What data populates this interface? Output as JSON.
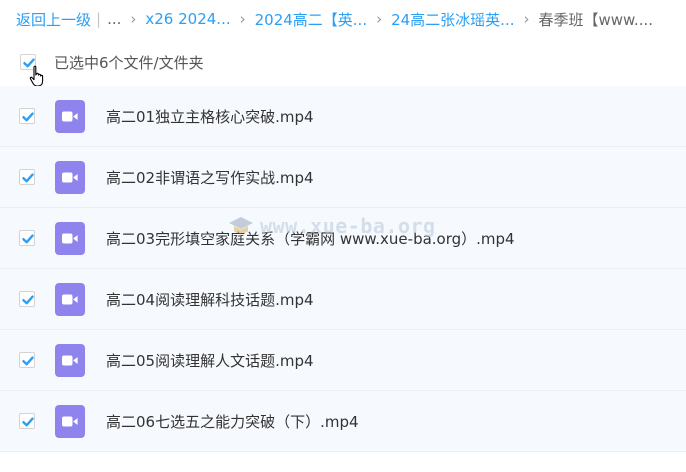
{
  "breadcrumb": {
    "back_label": "返回上一级",
    "sep_bar": "|",
    "ellipsis": "...",
    "sep": "›",
    "items": [
      "x26 2024...",
      "2024高二【英...",
      "24高二张冰瑶英..."
    ],
    "current": "春季班【www...."
  },
  "selection": {
    "label": "已选中6个文件/文件夹",
    "all_checked": true
  },
  "files": [
    {
      "name": "高二01独立主格核心突破.mp4",
      "checked": true,
      "type_icon": "video-file-icon"
    },
    {
      "name": "高二02非谓语之写作实战.mp4",
      "checked": true,
      "type_icon": "video-file-icon"
    },
    {
      "name": "高二03完形填空家庭关系（学霸网 www.xue-ba.org）.mp4",
      "checked": true,
      "type_icon": "video-file-icon"
    },
    {
      "name": "高二04阅读理解科技话题.mp4",
      "checked": true,
      "type_icon": "video-file-icon"
    },
    {
      "name": "高二05阅读理解人文话题.mp4",
      "checked": true,
      "type_icon": "video-file-icon"
    },
    {
      "name": "高二06七选五之能力突破（下）.mp4",
      "checked": true,
      "type_icon": "video-file-icon"
    }
  ],
  "watermark": {
    "text": "www.xue-ba.org"
  },
  "colors": {
    "link": "#2b9ff3",
    "check": "#2b9ff3",
    "row_bg": "#f6f9fe",
    "video_icon": "#8f83ee"
  }
}
